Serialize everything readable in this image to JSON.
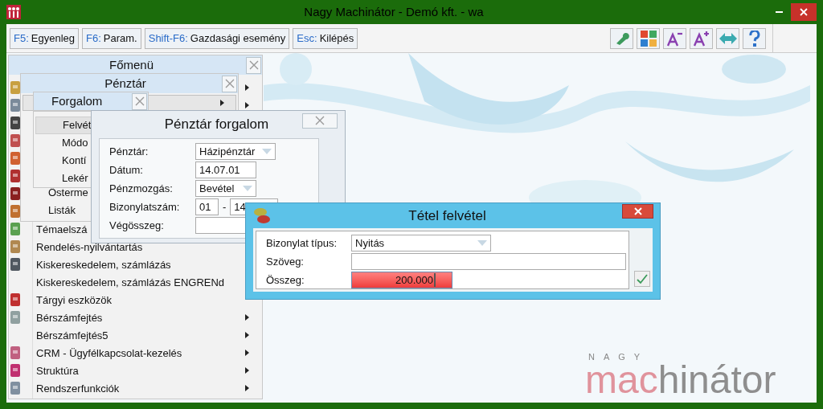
{
  "window": {
    "title": "Nagy Machinátor - Demó kft. - wa"
  },
  "toolbar": {
    "buttons": [
      {
        "key": "F5:",
        "label": "Egyenleg"
      },
      {
        "key": "F6:",
        "label": "Param."
      },
      {
        "key": "Shift-F6:",
        "label": "Gazdasági esemény"
      },
      {
        "key": "Esc:",
        "label": "Kilépés"
      }
    ]
  },
  "main_menu": {
    "title": "Főmenü",
    "items": [
      {
        "has_icon": true,
        "submenu": true
      },
      {
        "has_icon": true,
        "submenu": true
      },
      {
        "has_icon": true,
        "submenu": false
      },
      {
        "has_icon": true,
        "submenu": false
      },
      {
        "has_icon": true,
        "submenu": false
      },
      {
        "has_icon": true,
        "submenu": false
      },
      {
        "has_icon": true,
        "submenu": false
      },
      {
        "has_icon": true,
        "submenu": false
      },
      {
        "label": "Témaelszá",
        "has_icon": true
      },
      {
        "label": "Rendelés-nyilvántartás",
        "has_icon": true
      },
      {
        "label": "Kiskereskedelem, számlázás",
        "has_icon": true
      },
      {
        "label": "Kiskereskedelem, számlázás ENGRENd",
        "has_icon": false
      },
      {
        "label": "Tárgyi eszközök",
        "has_icon": true
      },
      {
        "label": "Bérszámfejtés",
        "has_icon": true,
        "submenu": true
      },
      {
        "label": "Bérszámfejtés5",
        "has_icon": false,
        "submenu": true
      },
      {
        "label": "CRM - Ügyfélkapcsolat-kezelés",
        "has_icon": true,
        "submenu": true
      },
      {
        "label": "Struktúra",
        "has_icon": true,
        "submenu": true
      },
      {
        "label": "Rendszerfunkciók",
        "has_icon": true,
        "submenu": true
      }
    ]
  },
  "cash_menu": {
    "title": "Pénztár",
    "items": [
      {
        "selected": true,
        "submenu": true
      },
      {
        "label": "Österme",
        "selected": false
      },
      {
        "label": "Listák",
        "selected": false
      }
    ]
  },
  "turnover_menu": {
    "title": "Forgalom",
    "items": [
      {
        "label": "Felvét",
        "selected": true
      },
      {
        "label": "Módo",
        "selected": false
      },
      {
        "label": "Kontí",
        "selected": false
      },
      {
        "label": "Lekér",
        "selected": false
      }
    ]
  },
  "cash_dialog": {
    "title": "Pénztár forgalom",
    "fields": [
      {
        "label": "Pénztár:",
        "kind": "dropdown",
        "value": "Házipénztár"
      },
      {
        "label": "Dátum:",
        "kind": "text",
        "value": "14.07.01"
      },
      {
        "label": "Pénzmozgás:",
        "kind": "dropdown",
        "value": "Bevétel"
      },
      {
        "label": "Bizonylatszám:",
        "kind": "pair",
        "value": "01",
        "separator": "-",
        "value2": "14"
      },
      {
        "label": "Végösszeg:",
        "kind": "text"
      }
    ]
  },
  "item_dialog": {
    "title": "Tétel felvétel",
    "fields": [
      {
        "label": "Bizonylat típus:",
        "kind": "dropdown",
        "value": "Nyitás"
      },
      {
        "label": "Szöveg:",
        "kind": "text"
      },
      {
        "label": "Összeg:",
        "kind": "amount",
        "value": "200.000",
        "invalid": true
      }
    ]
  },
  "logo": {
    "top": "NAGY",
    "parts": [
      {
        "text": "mac",
        "color": "#e0939c"
      },
      {
        "text": "hinátor",
        "color": "#8e8e8e"
      }
    ]
  }
}
